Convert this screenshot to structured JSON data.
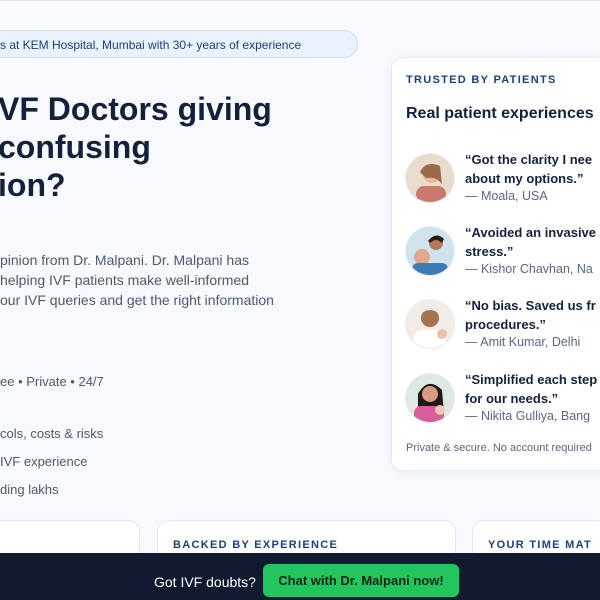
{
  "badge": {
    "text": "s at KEM Hospital, Mumbai with 30+ years of experience"
  },
  "hero": {
    "heading_lines": [
      "VF Doctors giving",
      "confusing",
      "ion?"
    ],
    "intro_lines": [
      "pinion from Dr. Malpani. Dr. Malpani has",
      "helping IVF patients make well-informed",
      "our IVF queries and get the right information"
    ],
    "meta": "ee • Private • 24/7",
    "bullets": [
      "cols, costs & risks",
      "IVF experience",
      "ding lakhs"
    ]
  },
  "testimonials": {
    "eyebrow": "TRUSTED BY PATIENTS",
    "title": "Real patient experiences",
    "reviews": [
      {
        "quote_lines": [
          "“Got the clarity I nee",
          "about my options.”"
        ],
        "author": "— Moala, USA"
      },
      {
        "quote_lines": [
          "“Avoided an invasive",
          "stress.”"
        ],
        "author": "— Kishor Chavhan, Na"
      },
      {
        "quote_lines": [
          "“No bias. Saved us fr",
          "procedures.”"
        ],
        "author": "— Amit Kumar, Delhi"
      },
      {
        "quote_lines": [
          "“Simplified each step",
          "for our needs.”"
        ],
        "author": "— Nikita Gulliya, Bang"
      }
    ],
    "footnote": "Private & secure. No account required"
  },
  "bottom_cards": {
    "card2_label": "BACKED BY EXPERIENCE",
    "card3_label": "YOUR TIME MAT"
  },
  "footer": {
    "prompt": "Got IVF doubts?",
    "cta_label": "Chat with Dr. Malpani now!"
  },
  "colors": {
    "accent": "#22c55e",
    "navy": "#111a2e",
    "badge_bg": "#e9f1fd",
    "heading": "#14213d"
  }
}
